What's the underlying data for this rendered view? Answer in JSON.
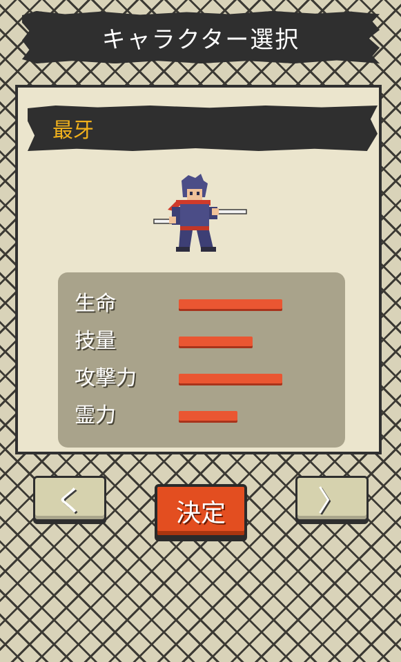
{
  "header": {
    "title": "キャラクター選択"
  },
  "character": {
    "name": "最牙",
    "sprite_icon": "ninja-character-sprite-icon",
    "stats": [
      {
        "label": "生命",
        "level": 1.0
      },
      {
        "label": "技量",
        "level": 0.71
      },
      {
        "label": "攻撃力",
        "level": 1.0
      },
      {
        "label": "霊力",
        "level": 0.57
      }
    ]
  },
  "controls": {
    "prev_label": "く",
    "confirm_label": "決定",
    "next_label": "〉"
  },
  "colors": {
    "stat_bar": "#ea5632",
    "name": "#f2b21c",
    "confirm": "#e34e20"
  }
}
